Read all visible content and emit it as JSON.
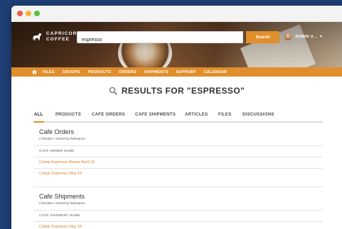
{
  "brand": {
    "line1": "CAPRICORN",
    "line2": "COFFEE"
  },
  "search": {
    "value": "espresso",
    "button": "Search"
  },
  "user": {
    "name": "ADMIN U..."
  },
  "nav": [
    "FILES",
    "GROUPS",
    "PRODUCTS",
    "ORDERS",
    "SHIPMENTS",
    "SUPPORT",
    "CALENDAR"
  ],
  "results": {
    "title": "RESULTS FOR \"ESPRESSO\""
  },
  "tabs": [
    "ALL",
    "PRODUCTS",
    "CAFE ORDERS",
    "CAFE SHIPMENTS",
    "ARTICLES",
    "FILES",
    "DISCUSSIONS"
  ],
  "sections": [
    {
      "title": "Cafe Orders",
      "meta": "2 Results • Sorted by Relevance",
      "column": "CAFE ORDER NAME",
      "rows": [
        "Cuban Espresso Beans April 16",
        "Cuban Espresso May 16"
      ]
    },
    {
      "title": "Cafe Shipments",
      "meta": "2 Results • Sorted by Relevance",
      "column": "CAFE SHIPMENT NAME",
      "rows": [
        "Cuban Espresso May 16"
      ]
    }
  ],
  "colors": {
    "accent": "#e08f2c",
    "link": "#d9822b",
    "background": "#1d3f74"
  }
}
